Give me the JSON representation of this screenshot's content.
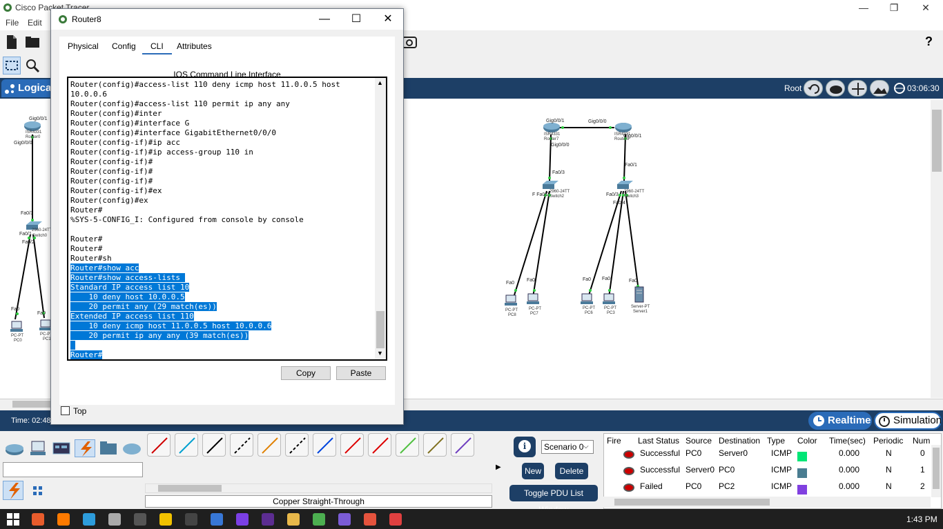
{
  "window": {
    "title": "Cisco Packet Tracer",
    "minimize": "—",
    "restore": "❐",
    "close": "✕"
  },
  "menu": {
    "file": "File",
    "edit": "Edit"
  },
  "toolbar": {
    "help": "?"
  },
  "logical": {
    "tab_label": "Logical",
    "root_label": "Root",
    "clock": "03:06:30"
  },
  "status": {
    "time": "Time: 02:48",
    "realtime": "Realtime",
    "simulation": "Simulation"
  },
  "router_dialog": {
    "title": "Router8",
    "tabs": [
      "Physical",
      "Config",
      "CLI",
      "Attributes"
    ],
    "active_tab": "CLI",
    "heading": "IOS Command Line Interface",
    "copy_label": "Copy",
    "paste_label": "Paste",
    "top_label": "Top",
    "terminal_lines": [
      {
        "text": "Router(config)#access-list 110 deny icmp host 11.0.0.5 host",
        "selected": false
      },
      {
        "text": "10.0.0.6",
        "selected": false
      },
      {
        "text": "Router(config)#access-list 110 permit ip any any",
        "selected": false
      },
      {
        "text": "Router(config)#inter",
        "selected": false
      },
      {
        "text": "Router(config)#interface G",
        "selected": false
      },
      {
        "text": "Router(config)#interface GigabitEthernet0/0/0",
        "selected": false
      },
      {
        "text": "Router(config-if)#ip acc",
        "selected": false
      },
      {
        "text": "Router(config-if)#ip access-group 110 in",
        "selected": false
      },
      {
        "text": "Router(config-if)#",
        "selected": false
      },
      {
        "text": "Router(config-if)#",
        "selected": false
      },
      {
        "text": "Router(config-if)#",
        "selected": false
      },
      {
        "text": "Router(config-if)#ex",
        "selected": false
      },
      {
        "text": "Router(config)#ex",
        "selected": false
      },
      {
        "text": "Router#",
        "selected": false
      },
      {
        "text": "%SYS-5-CONFIG_I: Configured from console by console",
        "selected": false
      },
      {
        "text": "",
        "selected": false
      },
      {
        "text": "Router#",
        "selected": false
      },
      {
        "text": "Router#",
        "selected": false
      },
      {
        "text": "Router#sh",
        "selected": false
      },
      {
        "text": "Router#show acc",
        "selected": true
      },
      {
        "text": "Router#show access-lists ",
        "selected": true
      },
      {
        "text": "Standard IP access list 10",
        "selected": true
      },
      {
        "text": "    10 deny host 10.0.0.5",
        "selected": true
      },
      {
        "text": "    20 permit any (29 match(es))",
        "selected": true
      },
      {
        "text": "Extended IP access list 110",
        "selected": true
      },
      {
        "text": "    10 deny icmp host 11.0.0.5 host 10.0.0.6",
        "selected": true
      },
      {
        "text": "    20 permit ip any any (39 match(es))",
        "selected": true
      },
      {
        "text": " ",
        "selected": true
      },
      {
        "text": "Router#",
        "selected": true
      }
    ]
  },
  "topology": {
    "left_cluster": {
      "router_port_top": "Gig0/0/1",
      "router_name": "ISR4331",
      "router_label": "Router0",
      "router_port_bottom": "Gig0/0/0",
      "switch_port_top": "Fa0/3",
      "switch_port_1": "Fa0/1",
      "switch_port_2": "Fa0/2",
      "switch_name": "2960-24TT",
      "switch_label": "Switch0",
      "pc_port_1": "Fa0",
      "pc_port_2": "Fa0",
      "pc0_type": "PC-PT",
      "pc0_label": "PC0",
      "pc1_type": "PC-PT",
      "pc1_label": "PC1"
    },
    "right_cluster": {
      "router7_port_left": "Gig0/0/1",
      "link_port": "Gig0/0/0",
      "router7_name": "ISR4331",
      "router7_label": "Router7",
      "router8_name": "ISR4331",
      "router8_label": "Router8",
      "router8_port": "Gig0/0/1",
      "router7_port_down": "Gig0/0/0",
      "switch2_port_top": "Fa0/3",
      "switch2_port_bottom": "F Fa0/2",
      "switch2_name": "2960-24TT",
      "switch2_label": "Switch2",
      "switch3_port_top": "Fa0/1",
      "switch3_port_1": "Fa0/3",
      "switch3_port_2": "Fa0/4",
      "switch3_name": "2960-24TT",
      "switch3_label": "Switch3",
      "pc8_port": "Fa0",
      "pc8_type": "PC-PT",
      "pc8_label": "PC8",
      "pc7_port": "Fa0",
      "pc7_type": "PC-PT",
      "pc7_label": "PC7",
      "pc6_port": "Fa0",
      "pc6_type": "PC-PT",
      "pc6_label": "PC6",
      "pc3_port": "Fa0",
      "pc3_type": "PC-PT",
      "pc3_label": "PC3",
      "server_port": "Fa0",
      "server_type": "Server-PT",
      "server_label": "Server1"
    }
  },
  "palette": {
    "cable_label": "Copper Straight-Through",
    "cable_colors": [
      "#d00000",
      "#00a0d0",
      "#000000",
      "#000000",
      "#e08000",
      "#000000",
      "#0044dd",
      "#dd0000",
      "#dd0000",
      "#50c040",
      "#807020",
      "#7040c0"
    ]
  },
  "scenario": {
    "info": "i",
    "selected": "Scenario 0",
    "new_label": "New",
    "delete_label": "Delete",
    "toggle_label": "Toggle PDU List Window"
  },
  "pdu_table": {
    "headers": [
      "Fire",
      "Last Status",
      "Source",
      "Destination",
      "Type",
      "Color",
      "Time(sec)",
      "Periodic",
      "Num"
    ],
    "rows": [
      {
        "status": "Successful",
        "source": "PC0",
        "destination": "Server0",
        "type": "ICMP",
        "color": "#00e676",
        "time": "0.000",
        "periodic": "N",
        "num": "0"
      },
      {
        "status": "Successful",
        "source": "Server0",
        "destination": "PC0",
        "type": "ICMP",
        "color": "#4a7d91",
        "time": "0.000",
        "periodic": "N",
        "num": "1"
      },
      {
        "status": "Failed",
        "source": "PC0",
        "destination": "PC2",
        "type": "ICMP",
        "color": "#8040e0",
        "time": "0.000",
        "periodic": "N",
        "num": "2"
      }
    ]
  },
  "taskbar": {
    "time": "1:43 PM"
  }
}
